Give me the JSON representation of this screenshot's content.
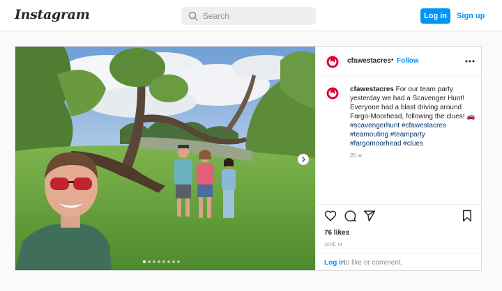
{
  "header": {
    "logo": "Instagram",
    "search_placeholder": "Search",
    "login_label": "Log in",
    "signup_label": "Sign up"
  },
  "post": {
    "username": "cfawestacres",
    "separator": "•",
    "follow_label": "Follow",
    "caption_text": "For our team party yesterday we had a Scavenger Hunt! Everyone had a blast driving around Fargo-Moorhead, following the clues!",
    "caption_emoji": "🚗",
    "hashtags": [
      "#scavengerhunt",
      "#cfawestacres",
      "#teamouting",
      "#teamparty",
      "#fargomoorhead",
      "#clues"
    ],
    "time_ago": "20 w",
    "likes": "76 likes",
    "date": "JUNE 14",
    "login_link": "Log in",
    "login_prompt": "to like or comment.",
    "carousel_count": 8,
    "carousel_active": 1
  },
  "colors": {
    "brand_blue": "#0095f6",
    "logo_red": "#dd0031",
    "hashtag": "#00376b"
  },
  "icons": {
    "search": "search-icon",
    "more": "more-icon",
    "like": "heart-icon",
    "comment": "comment-icon",
    "share": "share-icon",
    "save": "bookmark-icon",
    "next": "chevron-right-icon"
  }
}
